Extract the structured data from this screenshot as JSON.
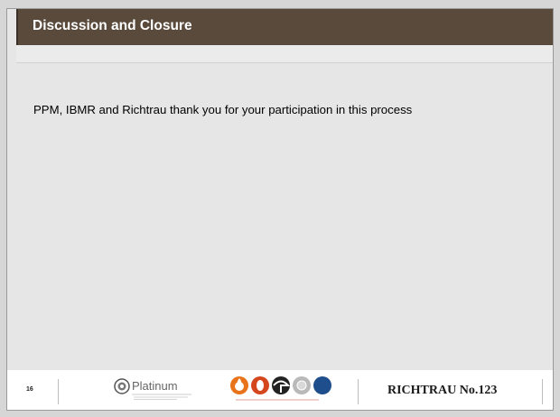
{
  "header": {
    "title": "Discussion and Closure"
  },
  "content": {
    "body_text": "PPM, IBMR and Richtrau thank you for your participation in this process"
  },
  "footer": {
    "page_number": "16",
    "platinum_logo_text": "Platinum",
    "brand_text": "RICHTRAU No.123"
  },
  "colors": {
    "title_bar": "#5a4a3c",
    "slide_background": "#e6e6e6",
    "footer_background": "#ffffff"
  },
  "icons": [
    "platinum-group-logo-icon",
    "partner-logos-icon"
  ]
}
